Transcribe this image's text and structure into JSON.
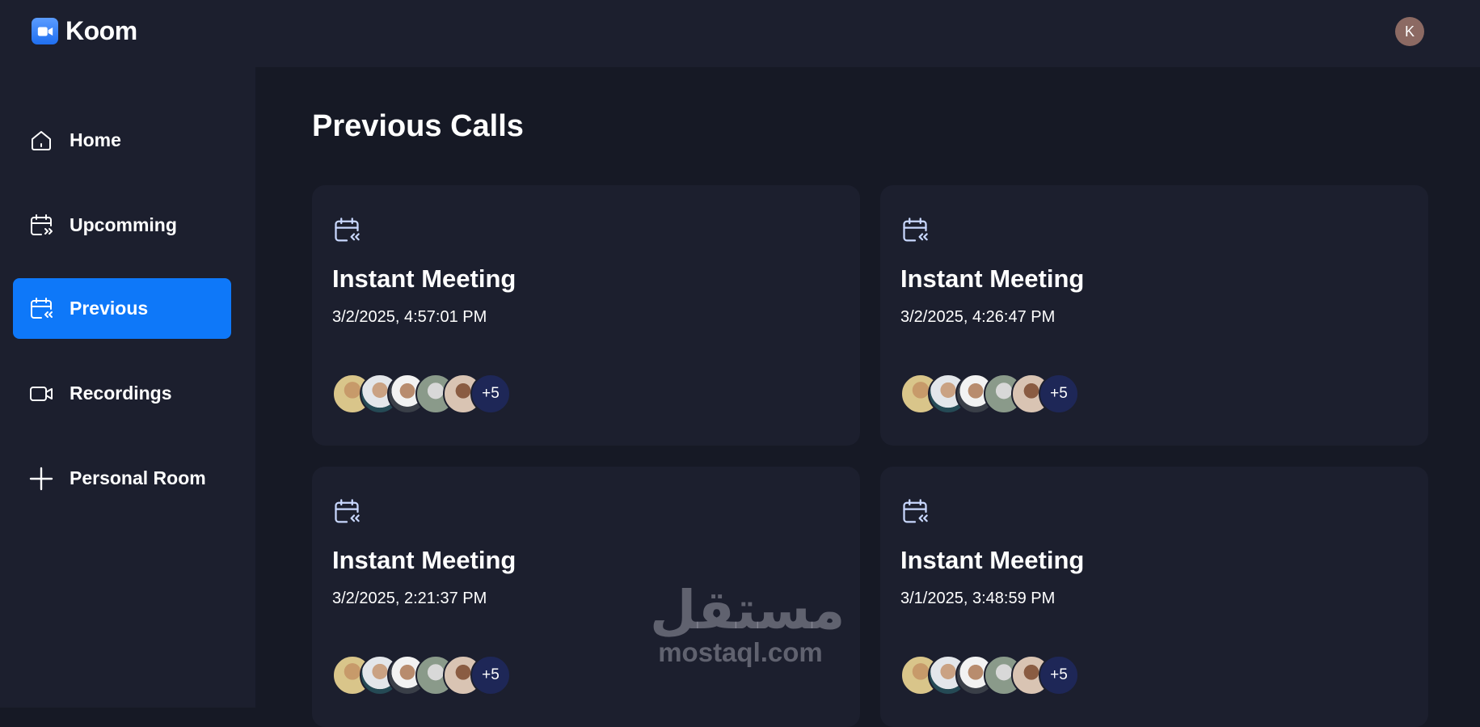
{
  "app": {
    "name": "Koom",
    "user_initial": "K"
  },
  "sidebar": {
    "items": [
      {
        "label": "Home",
        "icon": "home-icon",
        "active": false
      },
      {
        "label": "Upcomming",
        "icon": "calendar-forward-icon",
        "active": false
      },
      {
        "label": "Previous",
        "icon": "calendar-back-icon",
        "active": true
      },
      {
        "label": "Recordings",
        "icon": "video-icon",
        "active": false
      },
      {
        "label": "Personal Room",
        "icon": "plus-icon",
        "active": false
      }
    ]
  },
  "main": {
    "title": "Previous Calls",
    "cards": [
      {
        "title": "Instant Meeting",
        "date": "3/2/2025, 4:57:01 PM",
        "more_participants": "+5"
      },
      {
        "title": "Instant Meeting",
        "date": "3/2/2025, 4:26:47 PM",
        "more_participants": "+5"
      },
      {
        "title": "Instant Meeting",
        "date": "3/2/2025, 2:21:37 PM",
        "more_participants": "+5"
      },
      {
        "title": "Instant Meeting",
        "date": "3/1/2025, 3:48:59 PM",
        "more_participants": "+5"
      }
    ]
  },
  "watermark": {
    "arabic": "مستقل",
    "latin": "mostaql.com"
  },
  "colors": {
    "accent": "#0e78f9",
    "panel": "#1c1f2e",
    "background": "#161925",
    "participant_more": "#1e2757"
  }
}
